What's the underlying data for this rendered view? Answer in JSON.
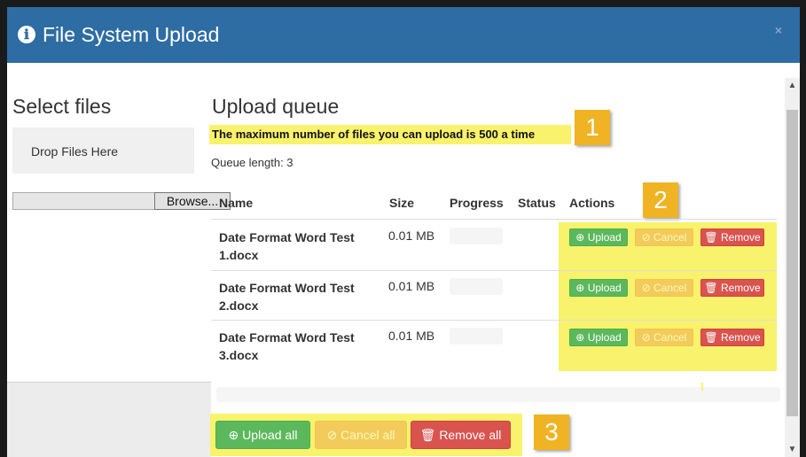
{
  "modal": {
    "title": "File System Upload",
    "info_icon": "ℹ",
    "close_label": "×"
  },
  "select_files": {
    "title": "Select files",
    "drop_zone_label": "Drop Files Here",
    "browse_label": "Browse..."
  },
  "queue": {
    "title": "Upload queue",
    "max_note": "The maximum number of files you can upload is 500 a time",
    "length_label": "Queue length: 3",
    "columns": [
      "Name",
      "Size",
      "Progress",
      "Status",
      "Actions"
    ],
    "rows": [
      {
        "name": "Date Format Word Test 1.docx",
        "size": "0.01 MB",
        "status": "",
        "progress": 0
      },
      {
        "name": "Date Format Word Test 2.docx",
        "size": "0.01 MB",
        "status": "",
        "progress": 0
      },
      {
        "name": "Date Format Word Test 3.docx",
        "size": "0.01 MB",
        "status": "",
        "progress": 0
      }
    ],
    "row_actions": {
      "upload_label": "Upload",
      "cancel_label": "Cancel",
      "remove_label": "Remove"
    },
    "total_progress": 0
  },
  "bulk_actions": {
    "upload_all_label": "Upload all",
    "cancel_all_label": "Cancel all",
    "remove_all_label": "Remove all"
  },
  "callouts": {
    "one": "1",
    "two": "2",
    "three": "3"
  },
  "icons": {
    "upload_icon": "⊕",
    "cancel_icon": "⊘",
    "remove_icon": "🗑"
  },
  "colors": {
    "header": "#2e6da4",
    "highlight": "#f8f26c",
    "callout": "#f0b323",
    "success": "#5cb85c",
    "warning": "#f0ad4e",
    "danger": "#d9534f"
  }
}
